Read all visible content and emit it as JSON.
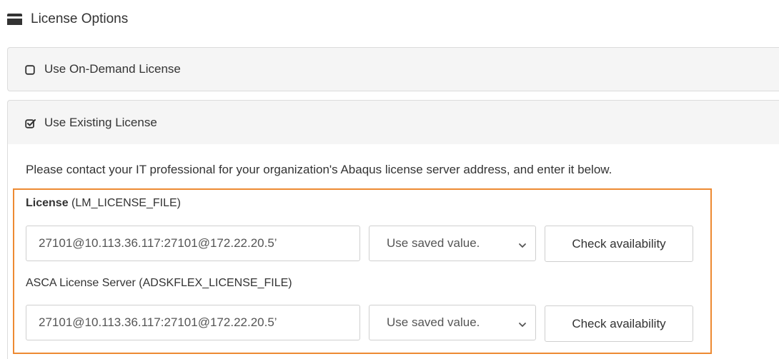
{
  "section": {
    "title": "License Options",
    "icon": "credit-card-icon"
  },
  "options": [
    {
      "label": "Use On-Demand License",
      "checked": false,
      "icon": "unchecked-box-icon"
    },
    {
      "label": "Use Existing License",
      "checked": true,
      "icon": "checked-box-icon"
    }
  ],
  "existing": {
    "info_text": "Please contact your IT professional for your organization's Abaqus license server address, and enter it below.",
    "highlight_color": "#ed8a32",
    "fields": [
      {
        "label_bold": "License",
        "label_rest": " (LM_LICENSE_FILE)",
        "value": "27101@10.113.36.117:27101@172.22.20.5’",
        "select_value": "Use saved value.",
        "button_label": "Check availability"
      },
      {
        "label_bold": "",
        "label_rest": "ASCA License Server (ADSKFLEX_LICENSE_FILE)",
        "value": "27101@10.113.36.117:27101@172.22.20.5’",
        "select_value": "Use saved value.",
        "button_label": "Check availability"
      }
    ]
  }
}
